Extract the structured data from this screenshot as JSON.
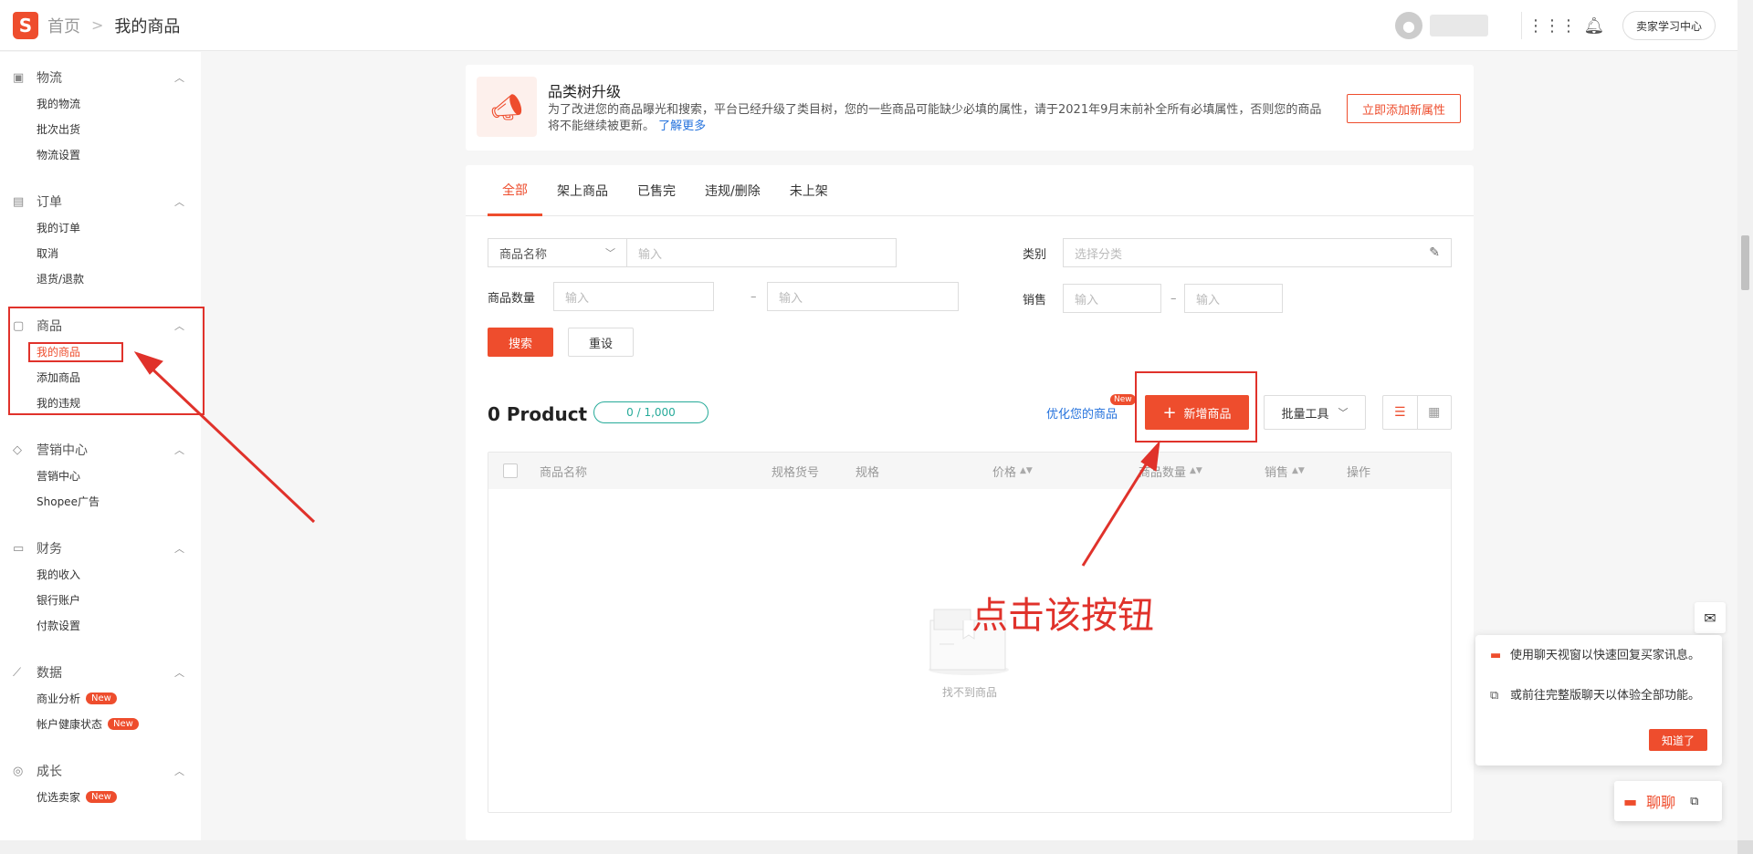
{
  "header": {
    "logo_letter": "S",
    "breadcrumb_home": "首页",
    "breadcrumb_sep": ">",
    "breadcrumb_current": "我的商品",
    "learning_center": "卖家学习中心"
  },
  "sidebar": {
    "groups": [
      {
        "label": "物流",
        "icon": "truck-icon",
        "items": [
          "我的物流",
          "批次出货",
          "物流设置"
        ]
      },
      {
        "label": "订单",
        "icon": "clipboard-icon",
        "items": [
          "我的订单",
          "取消",
          "退货/退款"
        ]
      },
      {
        "label": "商品",
        "icon": "bag-icon",
        "items": [
          "我的商品",
          "添加商品",
          "我的违规"
        ]
      },
      {
        "label": "营销中心",
        "icon": "tag-icon",
        "items": [
          "营销中心",
          "Shopee广告"
        ]
      },
      {
        "label": "财务",
        "icon": "wallet-icon",
        "items": [
          "我的收入",
          "银行账户",
          "付款设置"
        ]
      },
      {
        "label": "数据",
        "icon": "chart-icon",
        "items": [
          "商业分析",
          "帐户健康状态"
        ]
      },
      {
        "label": "成长",
        "icon": "badge-icon",
        "items": [
          "优选卖家"
        ]
      }
    ],
    "new_badge": "New"
  },
  "banner": {
    "title": "品类树升级",
    "text": "为了改进您的商品曝光和搜索，平台已经升级了类目树，您的一些商品可能缺少必填的属性，请于2021年9月末前补全所有必填属性，否则您的商品将不能继续被更新。",
    "link": "了解更多",
    "button": "立即添加新属性"
  },
  "tabs": [
    "全部",
    "架上商品",
    "已售完",
    "违规/删除",
    "未上架"
  ],
  "filters": {
    "name_select": "商品名称",
    "input_placeholder": "输入",
    "category_label": "类别",
    "category_placeholder": "选择分类",
    "quantity_label": "商品数量",
    "sales_label": "销售",
    "dash": "–",
    "search_button": "搜索",
    "reset_button": "重设"
  },
  "products": {
    "count_label": "0 Product",
    "quota": "0 / 1,000",
    "optimize_link": "优化您的商品",
    "optimize_badge": "New",
    "add_button": "新增商品",
    "batch_button": "批量工具"
  },
  "table": {
    "columns": [
      "商品名称",
      "规格货号",
      "规格",
      "价格",
      "商品数量",
      "销售",
      "操作"
    ],
    "empty_text": "找不到商品"
  },
  "annotation": {
    "text": "点击该按钮"
  },
  "chat": {
    "tip1": "使用聊天视窗以快速回复买家讯息。",
    "tip2": "或前往完整版聊天以体验全部功能。",
    "ok_button": "知道了",
    "label": "聊聊"
  },
  "colors": {
    "brand": "#ee4d2d",
    "annotation": "#e0322b",
    "link": "#2673dd",
    "quota": "#26aa99"
  }
}
